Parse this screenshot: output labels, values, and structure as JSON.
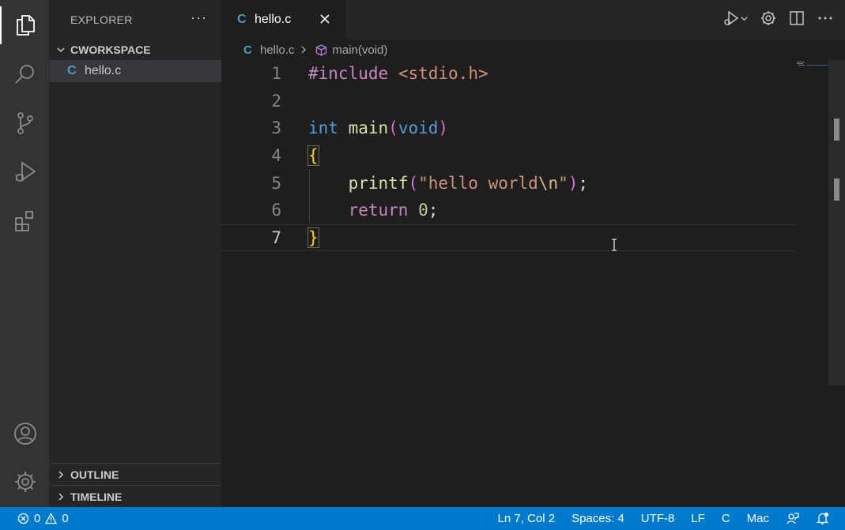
{
  "sidebar": {
    "title": "EXPLORER",
    "more": "···",
    "workspace": "CWORKSPACE",
    "file": "hello.c",
    "outline": "OUTLINE",
    "timeline": "TIMELINE"
  },
  "tab": {
    "icon_letter": "C",
    "label": "hello.c"
  },
  "breadcrumb": {
    "file": "hello.c",
    "symbol": "main(void)"
  },
  "editor": {
    "line_numbers": [
      "1",
      "2",
      "3",
      "4",
      "5",
      "6",
      "7"
    ],
    "l1": [
      "#include",
      " ",
      "<stdio.h>"
    ],
    "l3": [
      "int",
      " ",
      "main",
      "(",
      "void",
      ")"
    ],
    "l4": [
      "{"
    ],
    "l5": [
      "    ",
      "printf",
      "(",
      "\"hello world",
      "\\n",
      "\"",
      ")",
      ";"
    ],
    "l6": [
      "    ",
      "return",
      " ",
      "0",
      ";"
    ],
    "l7": [
      "}"
    ]
  },
  "status": {
    "errors": "0",
    "warnings": "0",
    "position": "Ln 7, Col 2",
    "spaces": "Spaces: 4",
    "encoding": "UTF-8",
    "eol": "LF",
    "language": "C",
    "platform": "Mac"
  },
  "colors": {
    "activity_bar": "#333333",
    "sidebar": "#252526",
    "editor": "#1e1e1e",
    "status_bar": "#007acc",
    "c_icon": "#519aba"
  }
}
